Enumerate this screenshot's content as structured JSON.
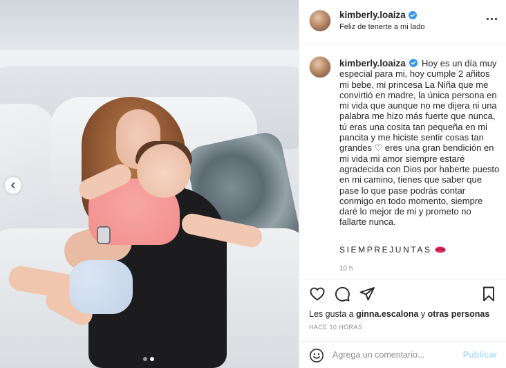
{
  "post": {
    "username": "kimberly.loaiza",
    "location": "Feliz de tenerte a mi lado",
    "caption": "Hoy es un día muy especial para mi, hoy cumple 2 añitos mi bebe, mi princesa La Niña que me convirtió en madre, la única persona en mi vida que aunque no me dijera ni una palabra me hizo más fuerte que nunca, tú eras una cosita tan pequeña en mi pancita y me hiciste sentir cosas tan grandes ♡ eres una gran bendición en mi vida mi amor siempre estaré agradecida con Dios por haberte puesto en mi camino, tienes que saber que pase lo que pase podrás contar conmigo en todo momento, siempre daré lo mejor de mi y prometo no fallarte nunca.",
    "tag": "SIEMPREJUNTAS",
    "caption_time": "10 h",
    "likes_prefix": "Les gusta a",
    "likes_user": "ginna.escalona",
    "likes_middle": "y",
    "likes_others": "otras personas",
    "post_time": "HACE 10 HORAS",
    "comment_placeholder": "Agrega un comentario...",
    "publish_label": "Publicar"
  },
  "carousel": {
    "total_slides": 2,
    "active_slide": 2
  },
  "colors": {
    "verified_blue": "#3897f0",
    "publish_disabled": "#b2dffc",
    "secondary_text": "#8e8e8e",
    "lips_red": "#e0245e"
  },
  "icons": {
    "verified": "verified-badge-icon",
    "more": "more-options-icon",
    "like": "heart-icon",
    "comment": "comment-icon",
    "share": "paper-plane-icon",
    "save": "bookmark-icon",
    "emoji": "emoji-icon",
    "prev": "chevron-left-icon",
    "lips": "lips-emoji-icon"
  }
}
